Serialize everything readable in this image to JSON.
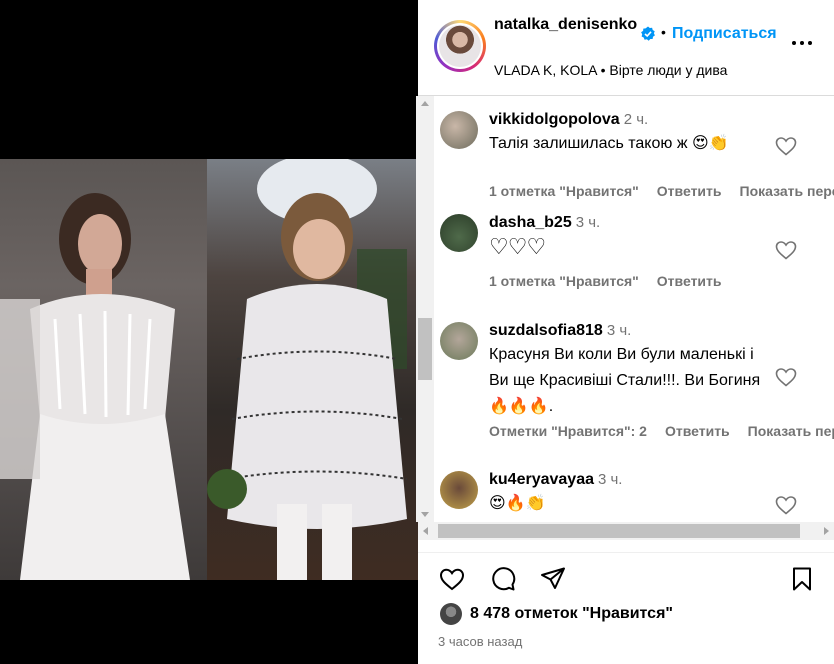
{
  "header": {
    "username": "natalka_denisenko",
    "dot": "•",
    "follow_label": "Подписаться",
    "subline": "VLADA K, KOLA • Вірте люди у дива"
  },
  "comments": [
    {
      "username": "vikkidolgopolova",
      "time": "2 ч.",
      "text": "Талія залишилась такою ж 😍👏",
      "likes": "1 отметка \"Нравится\"",
      "reply": "Ответить",
      "translate": "Показать перевод"
    },
    {
      "username": "dasha_b25",
      "time": "3 ч.",
      "text": "♡♡♡",
      "likes": "1 отметка \"Нравится\"",
      "reply": "Ответить"
    },
    {
      "username": "suzdalsofia818",
      "time": "3 ч.",
      "text": "Красуня Ви коли Ви були маленькі і Ви ще Красивіші Стали!!!. Ви Богиня🔥🔥🔥.",
      "likes": "Отметки \"Нравится\": 2",
      "reply": "Ответить",
      "translate": "Показать перевод"
    },
    {
      "username": "ku4eryavayaa",
      "time": "3 ч.",
      "text": "😍🔥👏"
    }
  ],
  "actions": {
    "likes_count": "8 478 отметок \"Нравится\"",
    "time_ago": "3 часов назад"
  },
  "icons": [
    "verified-badge-icon",
    "more-options-icon",
    "heart-icon",
    "comment-icon",
    "share-icon",
    "bookmark-icon"
  ],
  "colors": {
    "accent": "#0095f6",
    "muted": "#737373",
    "verified": "#0095f6"
  }
}
